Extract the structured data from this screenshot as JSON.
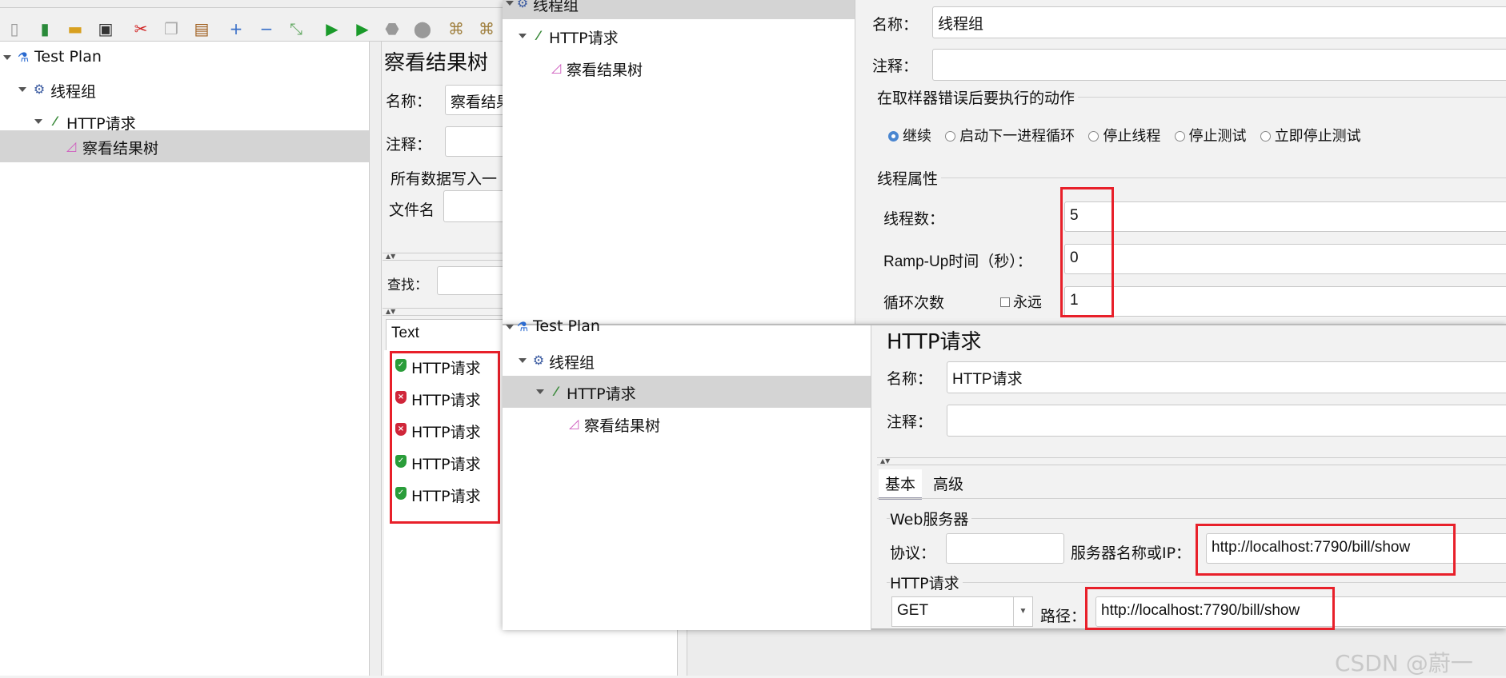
{
  "toolbar": {
    "icons": [
      "new-icon",
      "templates-icon",
      "open-icon",
      "save-icon",
      "cut-icon",
      "copy-icon",
      "paste-icon",
      "expand-icon",
      "collapse-icon",
      "toggle-icon",
      "start-icon",
      "start-no-pause-icon",
      "stop-icon",
      "shutdown-icon",
      "clear-icon",
      "clear-all-icon"
    ]
  },
  "main_tree": {
    "items": [
      {
        "label": "Test Plan"
      },
      {
        "label": "线程组"
      },
      {
        "label": "HTTP请求"
      },
      {
        "label": "察看结果树"
      }
    ]
  },
  "results_panel": {
    "title": "察看结果树",
    "name_label": "名称：",
    "name_value": "察看结果",
    "comment_label": "注释：",
    "write_all_label": "所有数据写入一",
    "filename_label": "文件名",
    "search_label": "查找：",
    "renderer_value": "Text",
    "results": [
      {
        "label": "HTTP请求",
        "status": "success"
      },
      {
        "label": "HTTP请求",
        "status": "error"
      },
      {
        "label": "HTTP请求",
        "status": "error"
      },
      {
        "label": "HTTP请求",
        "status": "success"
      },
      {
        "label": "HTTP请求",
        "status": "success"
      }
    ]
  },
  "thread_window": {
    "tree": [
      {
        "label": "线程组"
      },
      {
        "label": "HTTP请求"
      },
      {
        "label": "察看结果树"
      }
    ],
    "name_label": "名称：",
    "name_value": "线程组",
    "comment_label": "注释：",
    "comment_value": "",
    "error_action_title": "在取样器错误后要执行的动作",
    "error_actions": [
      {
        "label": "继续",
        "selected": true
      },
      {
        "label": "启动下一进程循环",
        "selected": false
      },
      {
        "label": "停止线程",
        "selected": false
      },
      {
        "label": "停止测试",
        "selected": false
      },
      {
        "label": "立即停止测试",
        "selected": false
      }
    ],
    "props_title": "线程属性",
    "threads_label": "线程数：",
    "threads_value": "5",
    "rampup_label": "Ramp-Up时间（秒）：",
    "rampup_value": "0",
    "loop_label": "循环次数",
    "forever_label": "永远",
    "forever_checked": false,
    "loop_value": "1"
  },
  "http_window": {
    "tree": [
      {
        "label": "Test Plan"
      },
      {
        "label": "线程组"
      },
      {
        "label": "HTTP请求"
      },
      {
        "label": "察看结果树"
      }
    ],
    "title": "HTTP请求",
    "name_label": "名称：",
    "name_value": "HTTP请求",
    "comment_label": "注释：",
    "comment_value": "",
    "tabs": [
      {
        "label": "基本",
        "active": true
      },
      {
        "label": "高级",
        "active": false
      }
    ],
    "web_server_title": "Web服务器",
    "protocol_label": "协议：",
    "protocol_value": "",
    "server_label": "服务器名称或IP：",
    "server_value": "http://localhost:7790/bill/show",
    "http_request_title": "HTTP请求",
    "method_value": "GET",
    "path_label": "路径：",
    "path_value": "http://localhost:7790/bill/show"
  },
  "watermark": "CSDN @蔚一",
  "colors": {
    "highlight": "#e8202a",
    "selected_row": "#d4d4d4",
    "success": "#2a9d3a",
    "error": "#d0263a"
  }
}
